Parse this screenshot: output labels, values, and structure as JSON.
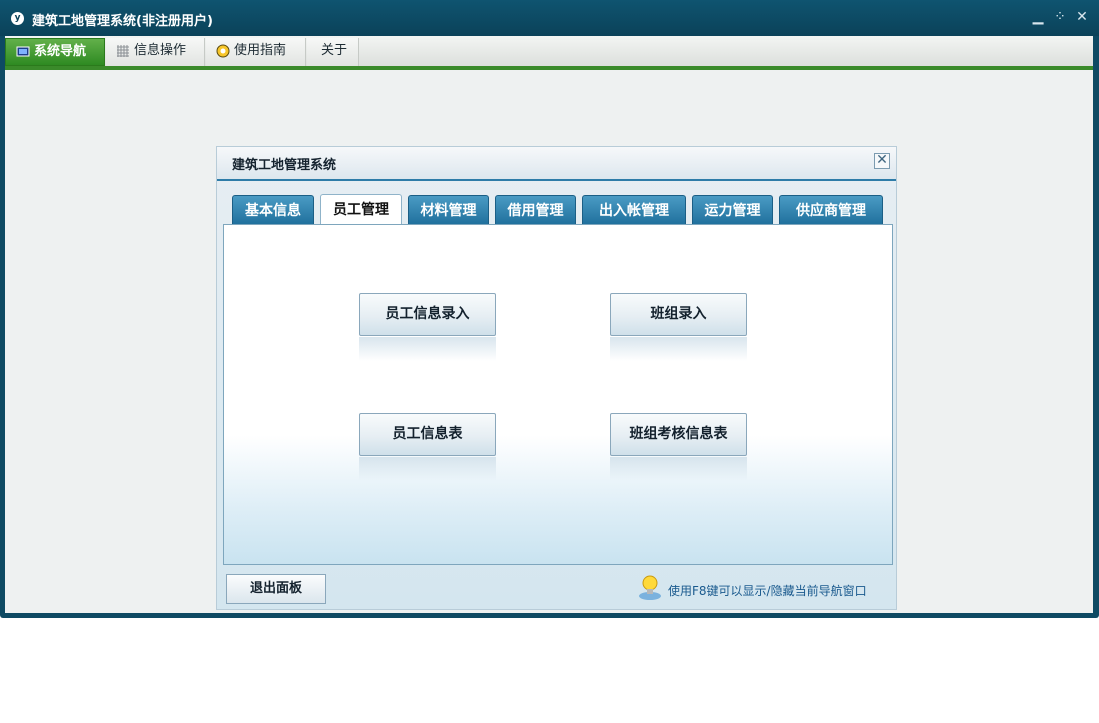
{
  "window": {
    "title": "建筑工地管理系统(非注册用户)",
    "logo_text": "y",
    "controls": {
      "minimize": "▁",
      "restore": "⁘",
      "close": "✕"
    }
  },
  "menubar": {
    "items": [
      {
        "label": "系统导航",
        "icon": "monitor-icon",
        "active": true
      },
      {
        "label": "信息操作",
        "icon": "grid-icon",
        "active": false
      },
      {
        "label": "使用指南",
        "icon": "guide-icon",
        "active": false
      },
      {
        "label": "关于",
        "icon": "",
        "active": false
      }
    ]
  },
  "panel": {
    "title": "建筑工地管理系统",
    "close_glyph": "✕",
    "tabs": [
      {
        "label": "基本信息",
        "active": false
      },
      {
        "label": "员工管理",
        "active": true
      },
      {
        "label": "材料管理",
        "active": false
      },
      {
        "label": "借用管理",
        "active": false
      },
      {
        "label": "出入帐管理",
        "active": false
      },
      {
        "label": "运力管理",
        "active": false
      },
      {
        "label": "供应商管理",
        "active": false
      }
    ],
    "buttons": [
      {
        "label": "员工信息录入"
      },
      {
        "label": "班组录入"
      },
      {
        "label": "员工信息表"
      },
      {
        "label": "班组考核信息表"
      }
    ],
    "exit_label": "退出面板",
    "hint": "使用F8键可以显示/隐藏当前导航窗口"
  },
  "colors": {
    "titlebar": "#0b4259",
    "menu_active": "#3a8a2a",
    "tab": "#2a7fad",
    "panel_accent": "#2e7ca8"
  }
}
